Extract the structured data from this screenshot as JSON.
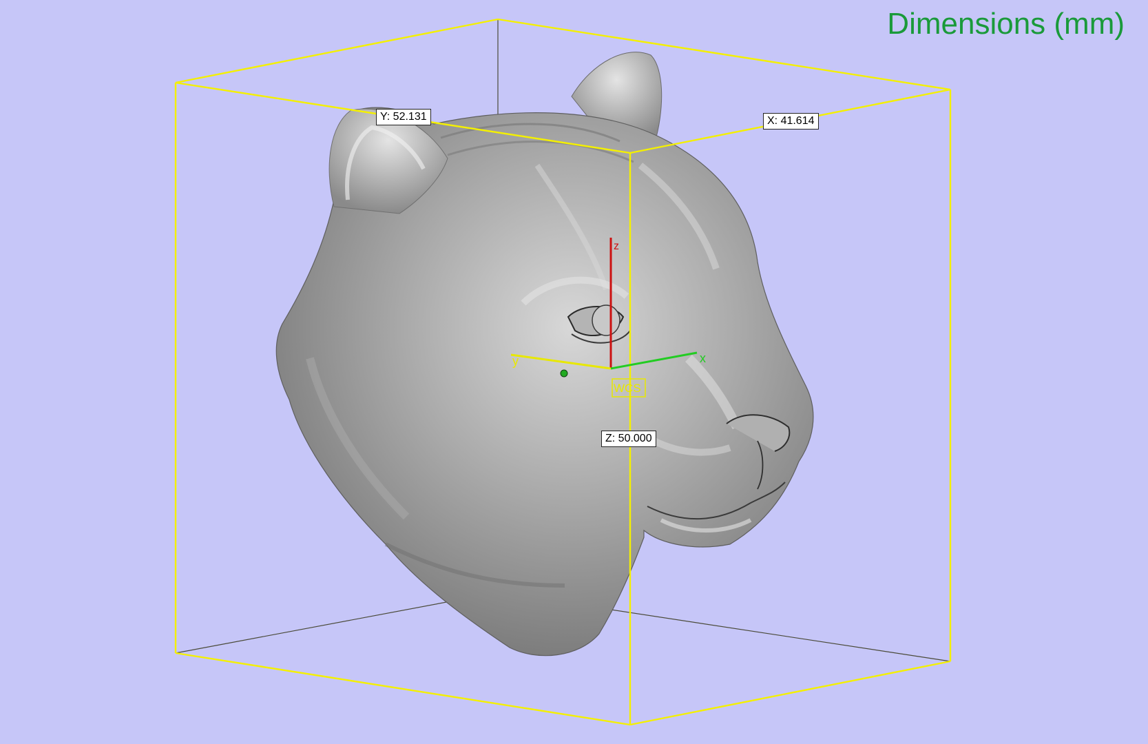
{
  "viewport": {
    "title": "Dimensions (mm)",
    "background_color": "#c6c6f8",
    "bbox_color": "#f4f000",
    "model_color": "#9a9a9a"
  },
  "dimensions": {
    "x_label": "X: 41.614",
    "y_label": "Y: 52.131",
    "z_label": "Z: 50.000"
  },
  "wcs": {
    "label": "WCS",
    "axis_x": "x",
    "axis_y": "y",
    "axis_z": "z",
    "x_color": "#22cc22",
    "y_color": "#e8e800",
    "z_color": "#cc1111"
  }
}
